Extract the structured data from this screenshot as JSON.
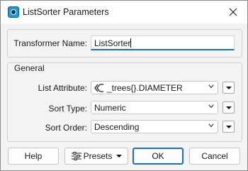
{
  "window": {
    "title": "ListSorter Parameters"
  },
  "transformer": {
    "label": "Transformer Name:",
    "value": "ListSorter"
  },
  "general": {
    "title": "General",
    "list_attribute": {
      "label": "List Attribute:",
      "value": "_trees{}.DIAMETER"
    },
    "sort_type": {
      "label": "Sort Type:",
      "value": "Numeric"
    },
    "sort_order": {
      "label": "Sort Order:",
      "value": "Descending"
    }
  },
  "buttons": {
    "help": "Help",
    "presets": "Presets",
    "ok": "OK",
    "cancel": "Cancel"
  },
  "colors": {
    "accent": "#1c6fb8",
    "app_icon": "#1f9ad6"
  }
}
